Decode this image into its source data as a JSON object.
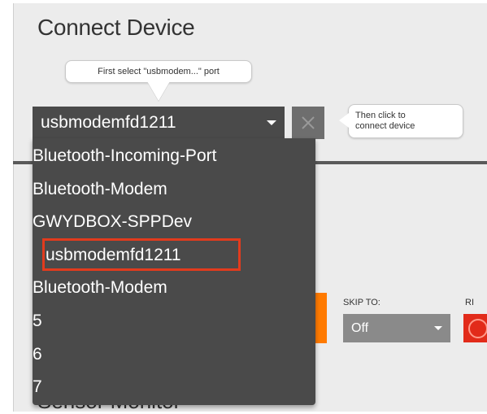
{
  "title": "Connect Device",
  "tooltip_select": "First select \"usbmodem...\" port",
  "tooltip_connect_line1": "Then click to",
  "tooltip_connect_line2": "connect device",
  "port_select": {
    "value": "usbmodemfd1211",
    "options": [
      "Bluetooth-Incoming-Port",
      "Bluetooth-Modem",
      "GWYDBOX-SPPDev",
      "usbmodemfd1211",
      "Bluetooth-Modem",
      "5",
      "6",
      "7"
    ]
  },
  "connect_button_icon": "x-icon",
  "skip_to": {
    "label": "SKIP TO:",
    "value": "Off"
  },
  "partial_label": "RI",
  "section_title": "Sensor Monitor",
  "colors": {
    "accent": "#ff7a00",
    "highlight": "#e23b1d",
    "dropdown_bg": "#4a4a4a"
  }
}
